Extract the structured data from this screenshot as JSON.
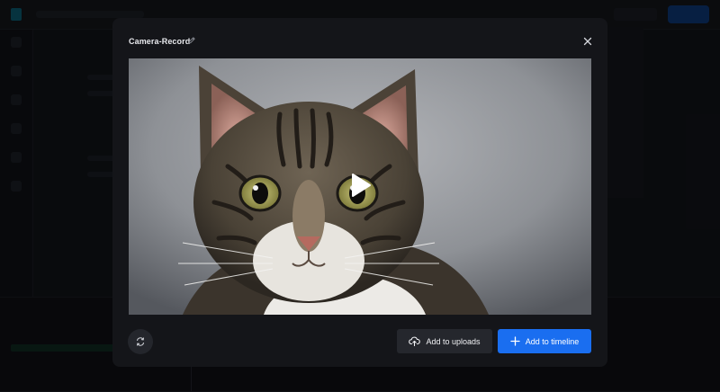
{
  "modal": {
    "title": "Camera-Record",
    "edit_icon": "pencil-icon",
    "close_icon": "close-icon"
  },
  "video": {
    "play_icon": "play-icon",
    "content": "tabby cat photo"
  },
  "actions": {
    "swap_icon": "swap-icon",
    "upload_label": "Add to uploads",
    "upload_icon": "cloud-upload-icon",
    "timeline_label": "Add to timeline",
    "timeline_icon": "plus-icon"
  },
  "colors": {
    "modal_bg": "#141519",
    "primary": "#1a6ef0",
    "secondary_btn": "#25272d"
  }
}
